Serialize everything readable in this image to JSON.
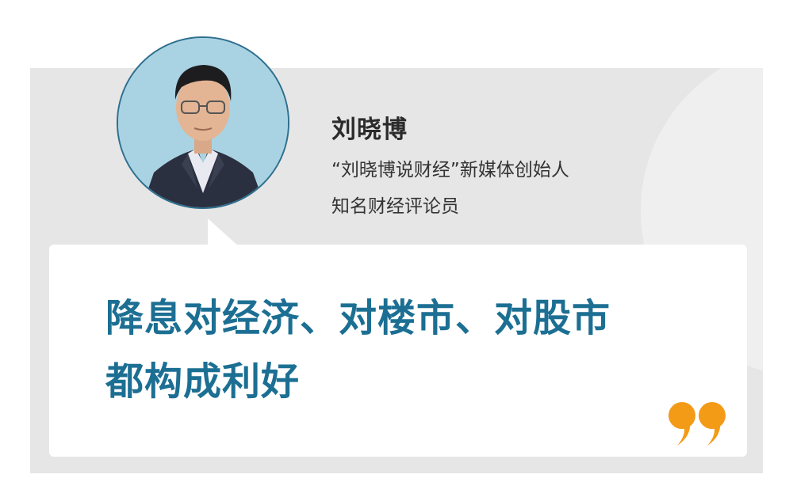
{
  "person": {
    "name": "刘晓博",
    "titles": [
      "“刘晓博说财经”新媒体创始人",
      "知名财经评论员"
    ]
  },
  "quote": {
    "lines": [
      "降息对经济、对楼市、对股市",
      "都构成利好"
    ]
  },
  "colors": {
    "accent_blue": "#1c6f93",
    "quote_mark": "#f39a17",
    "panel_bg": "#e6e6e6",
    "avatar_bg": "#a9d3e3"
  },
  "icons": {
    "avatar": "portrait-photo",
    "quote_mark": "closing-quote-icon"
  }
}
